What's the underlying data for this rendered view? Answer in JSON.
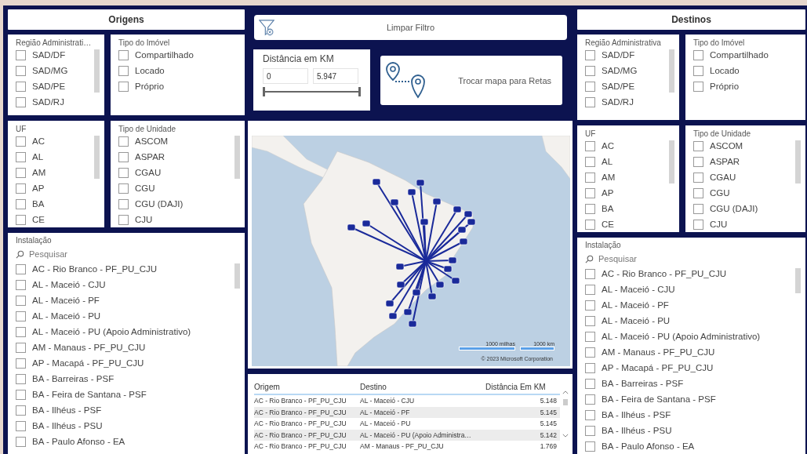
{
  "left_panel": {
    "title": "Origens",
    "filters": [
      {
        "title": "Região Administrati…",
        "items": [
          {
            "label": "SAD/DF",
            "checked": false
          },
          {
            "label": "SAD/MG",
            "checked": false
          },
          {
            "label": "SAD/PE",
            "checked": false
          },
          {
            "label": "SAD/RJ",
            "checked": false
          }
        ]
      },
      {
        "title": "Tipo do Imóvel",
        "items": [
          {
            "label": "Compartilhado",
            "checked": false
          },
          {
            "label": "Locado",
            "checked": false
          },
          {
            "label": "Próprio",
            "checked": false
          }
        ]
      },
      {
        "title": "UF",
        "items": [
          {
            "label": "AC",
            "checked": false
          },
          {
            "label": "AL",
            "checked": false
          },
          {
            "label": "AM",
            "checked": false
          },
          {
            "label": "AP",
            "checked": false
          },
          {
            "label": "BA",
            "checked": false
          },
          {
            "label": "CE",
            "checked": false
          }
        ]
      },
      {
        "title": "Tipo de Unidade",
        "items": [
          {
            "label": "ASCOM",
            "checked": false
          },
          {
            "label": "ASPAR",
            "checked": false
          },
          {
            "label": "CGAU",
            "checked": false
          },
          {
            "label": "CGU",
            "checked": false
          },
          {
            "label": "CGU (DAJI)",
            "checked": false
          },
          {
            "label": "CJU",
            "checked": false
          }
        ]
      }
    ],
    "installation": {
      "title": "Instalação",
      "placeholder": "Pesquisar",
      "items": [
        {
          "label": "AC - Rio Branco - PF_PU_CJU",
          "checked": false
        },
        {
          "label": "AL - Maceió - CJU",
          "checked": false
        },
        {
          "label": "AL - Maceió - PF",
          "checked": false
        },
        {
          "label": "AL - Maceió - PU",
          "checked": false
        },
        {
          "label": "AL - Maceió - PU (Apoio Administrativo)",
          "checked": false
        },
        {
          "label": "AM - Manaus - PF_PU_CJU",
          "checked": false
        },
        {
          "label": "AP - Macapá - PF_PU_CJU",
          "checked": false
        },
        {
          "label": "BA - Barreiras - PSF",
          "checked": false
        },
        {
          "label": "BA - Feira de Santana - PSF",
          "checked": false
        },
        {
          "label": "BA - Ilhéus - PSF",
          "checked": false
        },
        {
          "label": "BA - Ilhéus - PSU",
          "checked": false
        },
        {
          "label": "BA - Paulo Afonso - EA",
          "checked": false
        }
      ]
    }
  },
  "center": {
    "clear_button": "Limpar Filtro",
    "distance_filter": {
      "title": "Distância em KM",
      "min": "0",
      "max": "5.947",
      "level": 1
    },
    "map_toggle_button": "Trocar mapa para Retas",
    "map": {
      "scale_miles": "1000 milhas",
      "scale_km": "1000 km",
      "copyright": "© 2023 Microsoft Corporation"
    },
    "table": {
      "columns": [
        "Origem",
        "Destino",
        "Distância Em KM"
      ],
      "rows": [
        [
          "AC - Rio Branco - PF_PU_CJU",
          "AL - Maceió - CJU",
          "5.148"
        ],
        [
          "AC - Rio Branco - PF_PU_CJU",
          "AL - Maceió - PF",
          "5.145"
        ],
        [
          "AC - Rio Branco - PF_PU_CJU",
          "AL - Maceió - PU",
          "5.145"
        ],
        [
          "AC - Rio Branco - PF_PU_CJU",
          "AL - Maceió - PU (Apoio Administra…",
          "5.142"
        ],
        [
          "AC - Rio Branco - PF_PU_CJU",
          "AM - Manaus - PF_PU_CJU",
          "1.769"
        ]
      ]
    }
  },
  "right_panel": {
    "title": "Destinos",
    "filters": [
      {
        "title": "Região Administrativa",
        "items": [
          {
            "label": "SAD/DF",
            "checked": false
          },
          {
            "label": "SAD/MG",
            "checked": false
          },
          {
            "label": "SAD/PE",
            "checked": false
          },
          {
            "label": "SAD/RJ",
            "checked": false
          }
        ]
      },
      {
        "title": "Tipo do Imóvel",
        "items": [
          {
            "label": "Compartilhado",
            "checked": false
          },
          {
            "label": "Locado",
            "checked": false
          },
          {
            "label": "Próprio",
            "checked": false
          }
        ]
      },
      {
        "title": "UF",
        "items": [
          {
            "label": "AC",
            "checked": false
          },
          {
            "label": "AL",
            "checked": false
          },
          {
            "label": "AM",
            "checked": false
          },
          {
            "label": "AP",
            "checked": false
          },
          {
            "label": "BA",
            "checked": false
          },
          {
            "label": "CE",
            "checked": false
          }
        ]
      },
      {
        "title": "Tipo de Unidade",
        "items": [
          {
            "label": "ASCOM",
            "checked": false
          },
          {
            "label": "ASPAR",
            "checked": false
          },
          {
            "label": "CGAU",
            "checked": false
          },
          {
            "label": "CGU",
            "checked": false
          },
          {
            "label": "CGU (DAJI)",
            "checked": false
          },
          {
            "label": "CJU",
            "checked": false
          }
        ]
      }
    ],
    "installation": {
      "title": "Instalação",
      "placeholder": "Pesquisar",
      "items": [
        {
          "label": "AC - Rio Branco - PF_PU_CJU",
          "checked": false
        },
        {
          "label": "AL - Maceió - CJU",
          "checked": false
        },
        {
          "label": "AL - Maceió - PF",
          "checked": false
        },
        {
          "label": "AL - Maceió - PU",
          "checked": false
        },
        {
          "label": "AL - Maceió - PU (Apoio Administrativo)",
          "checked": false
        },
        {
          "label": "AM - Manaus - PF_PU_CJU",
          "checked": false
        },
        {
          "label": "AP - Macapá - PF_PU_CJU",
          "checked": false
        },
        {
          "label": "BA - Barreiras - PSF",
          "checked": false
        },
        {
          "label": "BA - Feira de Santana - PSF",
          "checked": false
        },
        {
          "label": "BA - Ilhéus - PSF",
          "checked": false
        },
        {
          "label": "BA - Ilhéus - PSU",
          "checked": false
        },
        {
          "label": "BA - Paulo Afonso - EA",
          "checked": false
        }
      ]
    }
  }
}
